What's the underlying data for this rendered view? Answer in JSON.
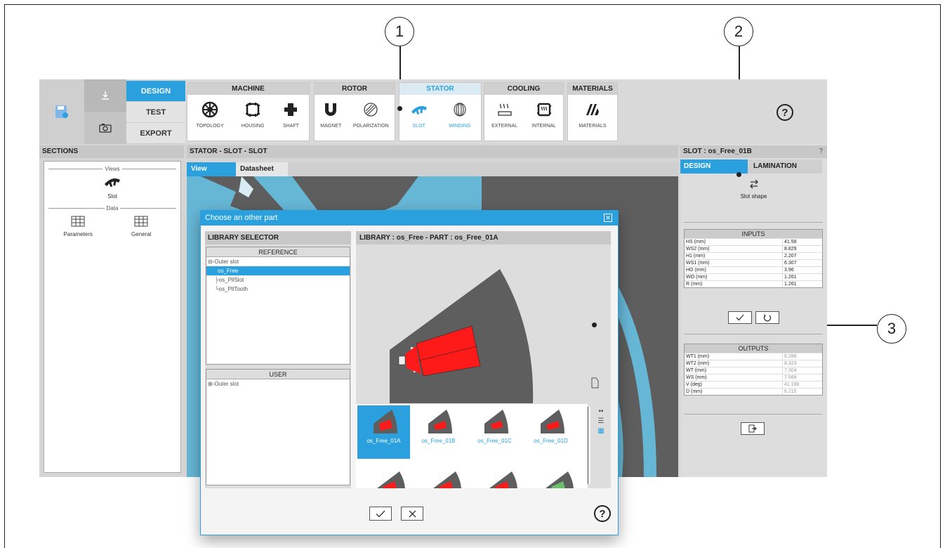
{
  "callouts": [
    "1",
    "2",
    "3"
  ],
  "toolbar": {
    "modes": [
      "DESIGN",
      "TEST",
      "EXPORT"
    ],
    "groups": [
      {
        "title": "MACHINE",
        "items": [
          "TOPOLOGY",
          "HOUSING",
          "SHAFT"
        ]
      },
      {
        "title": "ROTOR",
        "items": [
          "MAGNET",
          "POLARIZATION"
        ]
      },
      {
        "title": "STATOR",
        "items": [
          "SLOT",
          "WINDING"
        ]
      },
      {
        "title": "COOLING",
        "items": [
          "EXTERNAL",
          "INTERNAL"
        ]
      },
      {
        "title": "MATERIALS",
        "items": [
          "MATERIALS"
        ]
      }
    ],
    "help": "?"
  },
  "sections": {
    "title": "SECTIONS",
    "views_label": "Views",
    "data_label": "Data",
    "views": [
      "Slot"
    ],
    "data": [
      "Parameters",
      "General"
    ]
  },
  "center": {
    "title": "STATOR - SLOT - SLOT",
    "tabs": [
      "View",
      "Datasheet"
    ]
  },
  "right": {
    "title": "SLOT : os_Free_01B",
    "help": "?",
    "tabs": [
      "DESIGN",
      "LAMINATION"
    ],
    "slot_shape_label": "Slot shape",
    "inputs_title": "INPUTS",
    "inputs": [
      {
        "k": "HS (mm)",
        "v": "41.58"
      },
      {
        "k": "WS2 (mm)",
        "v": "8.829"
      },
      {
        "k": "H1 (mm)",
        "v": "2.207"
      },
      {
        "k": "WS1 (mm)",
        "v": "6.307"
      },
      {
        "k": "HO (mm)",
        "v": "3.96"
      },
      {
        "k": "WO (mm)",
        "v": "1.261"
      },
      {
        "k": "R (mm)",
        "v": "1.261"
      }
    ],
    "outputs_title": "OUTPUTS",
    "outputs": [
      {
        "k": "WT1 (mm)",
        "v": "6.286"
      },
      {
        "k": "WT2 (mm)",
        "v": "8.323"
      },
      {
        "k": "WT (mm)",
        "v": "7.304"
      },
      {
        "k": "WS (mm)",
        "v": "7.568"
      },
      {
        "k": "V (deg)",
        "v": "41.186"
      },
      {
        "k": "D (mm)",
        "v": "6.215"
      }
    ]
  },
  "dialog": {
    "title": "Choose an other part",
    "library_selector": "LIBRARY SELECTOR",
    "reference": "REFERENCE",
    "reference_tree": [
      "Outer slot",
      "os_Free",
      "os_PllSlot",
      "os_PllTooth"
    ],
    "user": "USER",
    "user_tree": [
      "Outer slot"
    ],
    "preview_title": "LIBRARY : os_Free   -   PART : os_Free_01A",
    "thumbs": [
      "os_Free_01A",
      "os_Free_01B",
      "os_Free_01C",
      "os_Free_01D"
    ],
    "help": "?"
  },
  "colors": {
    "accent": "#2aa1de",
    "slot": "#ff1a1a",
    "lamination": "#5e5e5e",
    "view_bg": "#66b7d6"
  }
}
